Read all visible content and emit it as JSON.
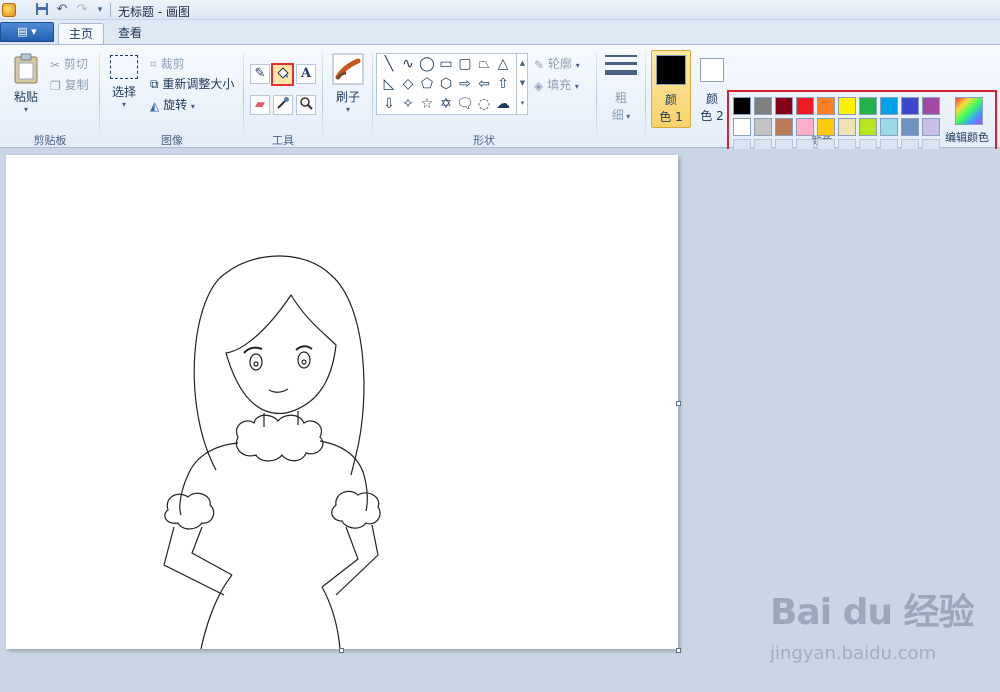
{
  "window": {
    "title": "无标题 - 画图"
  },
  "menu": {
    "app_menu_label": "▤ ▾"
  },
  "tabs": [
    {
      "label": "主页"
    },
    {
      "label": "查看"
    }
  ],
  "clipboard": {
    "paste": "粘贴",
    "cut": "剪切",
    "copy": "复制",
    "group": "剪贴板"
  },
  "image": {
    "select": "选择",
    "crop": "裁剪",
    "resize": "重新调整大小",
    "rotate": "旋转",
    "group": "图像"
  },
  "tools": {
    "group": "工具"
  },
  "brushes": {
    "label": "刷子"
  },
  "shapes": {
    "outline": "轮廓",
    "fill": "填充",
    "group": "形状"
  },
  "size": {
    "label_1": "粗",
    "label_2": "细"
  },
  "colors": {
    "color1_label_1": "颜",
    "color1_label_2": "色 1",
    "color2_label_1": "颜",
    "color2_label_2": "色 2",
    "edit_colors": "编辑颜色",
    "group": "颜色",
    "color1": "#000000",
    "color2": "#ffffff",
    "palette_row1": [
      "#000000",
      "#7f7f7f",
      "#880015",
      "#ed1c24",
      "#ff7f27",
      "#fff200",
      "#22b14c",
      "#00a2e8",
      "#3f48cc",
      "#a349a4"
    ],
    "palette_row2": [
      "#ffffff",
      "#c3c3c3",
      "#b97a57",
      "#ffaec9",
      "#ffc90e",
      "#efe4b0",
      "#b5e61d",
      "#99d9ea",
      "#7092be",
      "#c8bfe7"
    ]
  },
  "watermark": {
    "logo": "Bai du 经验",
    "url": "jingyan.baidu.com"
  }
}
